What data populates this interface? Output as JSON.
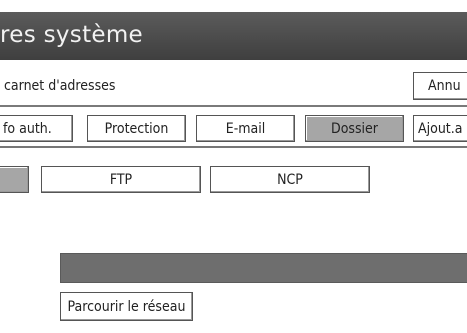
{
  "header": {
    "title": "res système"
  },
  "subheader": {
    "text": "carnet d'adresses",
    "cancel_label": "Annu"
  },
  "tabs": [
    {
      "label": "fo auth.",
      "selected": false
    },
    {
      "label": "Protection",
      "selected": false
    },
    {
      "label": "E-mail",
      "selected": false
    },
    {
      "label": "Dossier",
      "selected": true
    },
    {
      "label": "Ajout.a",
      "selected": false
    }
  ],
  "protocols": [
    {
      "label": "",
      "selected": true
    },
    {
      "label": "FTP",
      "selected": false
    },
    {
      "label": "NCP",
      "selected": false
    }
  ],
  "path_field": {
    "value": ""
  },
  "browse": {
    "label": "Parcourir le réseau"
  },
  "colors": {
    "title_bar": "#4a4a4a",
    "selected_tab": "#a6a6a6"
  }
}
